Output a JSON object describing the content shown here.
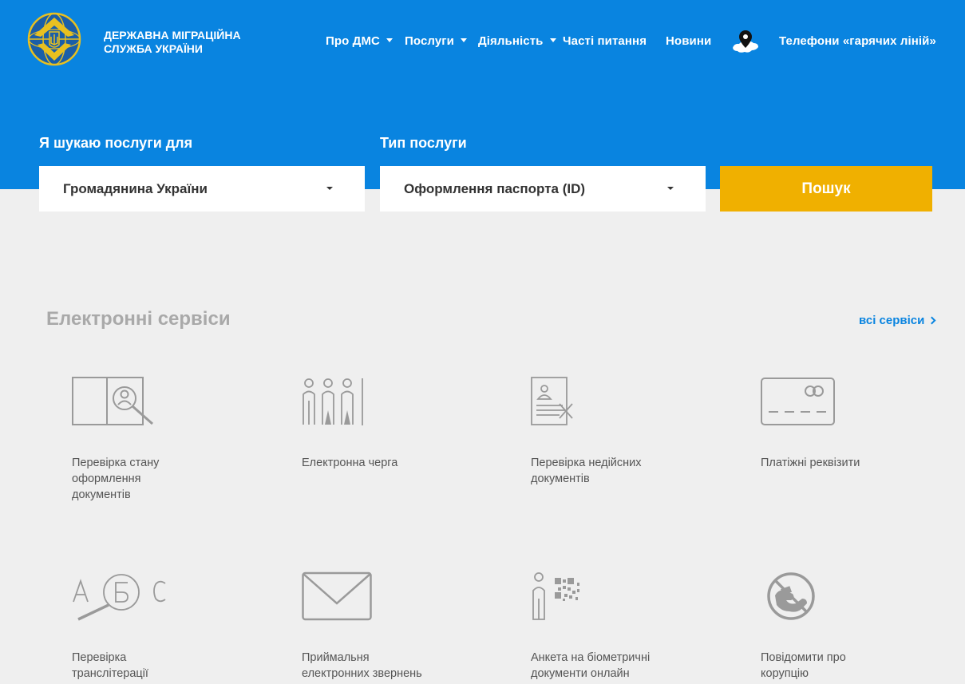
{
  "brand": {
    "line1": "ДЕРЖАВНА МІГРАЦІЙНА",
    "line2": "СЛУЖБА УКРАЇНИ"
  },
  "nav": [
    {
      "label": "Про ДМС",
      "dropdown": true
    },
    {
      "label": "Послуги",
      "dropdown": true
    },
    {
      "label": "Діяльність",
      "dropdown": true
    },
    {
      "label": "Часті питання",
      "dropdown": false
    },
    {
      "label": "Новини",
      "dropdown": false
    }
  ],
  "hotlines": "Телефони «гарячих ліній»",
  "search": {
    "for_label": "Я шукаю послуги для",
    "for_value": "Громадянина України",
    "type_label": "Тип послуги",
    "type_value": "Оформлення паспорта (ID)",
    "button": "Пошук"
  },
  "services": {
    "title": "Електронні сервіси",
    "all_link": "всі сервіси",
    "items": [
      {
        "icon": "passport-search-icon",
        "lines": [
          "Перевірка стану",
          "оформлення",
          "документів"
        ]
      },
      {
        "icon": "queue-people-icon",
        "lines": [
          "Електронна черга"
        ]
      },
      {
        "icon": "invalid-document-icon",
        "lines": [
          "Перевірка недійсних",
          "документів"
        ]
      },
      {
        "icon": "payment-card-icon",
        "lines": [
          "Платіжні реквізити"
        ]
      },
      {
        "icon": "transliteration-icon",
        "lines": [
          "Перевірка",
          "транслітерації"
        ]
      },
      {
        "icon": "envelope-icon",
        "lines": [
          "Приймальня",
          "електронних звернень"
        ]
      },
      {
        "icon": "biometric-qr-icon",
        "lines": [
          "Анкета на біометричні",
          "документи онлайн"
        ]
      },
      {
        "icon": "no-corruption-icon",
        "lines": [
          "Повідомити про",
          "корупцію"
        ]
      }
    ]
  },
  "colors": {
    "primary": "#0984e0",
    "accent": "#f0b000",
    "background": "#efefef",
    "icon": "#9a9a9a"
  }
}
